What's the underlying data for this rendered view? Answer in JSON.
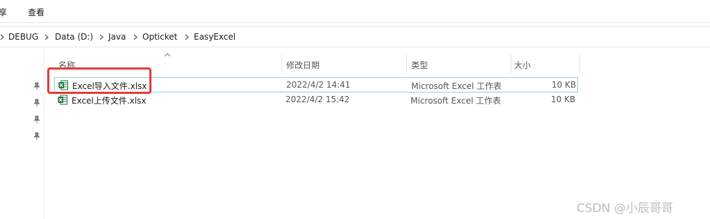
{
  "ribbon": {
    "tabs": [
      {
        "label": "享"
      },
      {
        "label": "查看"
      }
    ]
  },
  "breadcrumb": {
    "items": [
      "DEBUG",
      "Data (D:)",
      "Java",
      "Opticket",
      "EasyExcel"
    ]
  },
  "columns": {
    "name": "名称",
    "modified": "修改日期",
    "type": "类型",
    "size": "大小"
  },
  "files": [
    {
      "name": "Excel导入文件.xlsx",
      "modified": "2022/4/2 14:41",
      "type": "Microsoft Excel 工作表",
      "size": "10 KB",
      "selected": true
    },
    {
      "name": "Excel上传文件.xlsx",
      "modified": "2022/4/2 15:42",
      "type": "Microsoft Excel 工作表",
      "size": "10 KB",
      "selected": false
    }
  ],
  "watermark": "CSDN @小辰哥哥",
  "colors": {
    "highlight_box": "#e53935",
    "selection_border": "#99c9dd",
    "excel_green": "#1d6f42"
  }
}
